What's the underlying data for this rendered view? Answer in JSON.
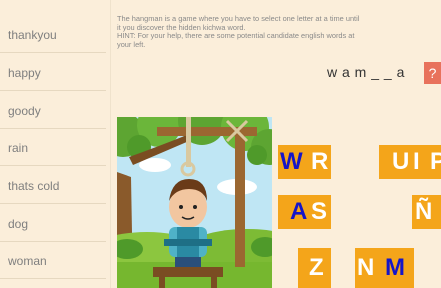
{
  "sidebar": {
    "items": [
      {
        "label": "thankyou"
      },
      {
        "label": "happy"
      },
      {
        "label": "goody"
      },
      {
        "label": "rain"
      },
      {
        "label": "thats cold"
      },
      {
        "label": "dog"
      },
      {
        "label": "woman"
      }
    ]
  },
  "instructions": {
    "line1": "The hangman is a game where you have to select one letter at a time until",
    "line2": "it you discover the hidden kichwa word.",
    "line3": "HINT: For your help, there are some potential candidate english words at",
    "line4": "your left."
  },
  "game": {
    "word_display": "w a m _ _ a",
    "hint_button_label": "?",
    "letters": [
      {
        "text": "W",
        "used": true
      },
      {
        "text": "R",
        "used": false
      },
      {
        "text": "U",
        "used": false
      },
      {
        "text": "I",
        "used": false
      },
      {
        "text": "P",
        "used": false
      },
      {
        "text": "A",
        "used": true
      },
      {
        "text": "S",
        "used": false
      },
      {
        "text": "Ñ",
        "used": false
      },
      {
        "text": "Z",
        "used": false
      },
      {
        "text": "N",
        "used": false
      },
      {
        "text": "M",
        "used": true
      }
    ]
  },
  "colors": {
    "background": "#fbeeda",
    "tile": "#f4a51a",
    "tile_used_text": "#1515c8",
    "hint_button": "#e8725c"
  }
}
